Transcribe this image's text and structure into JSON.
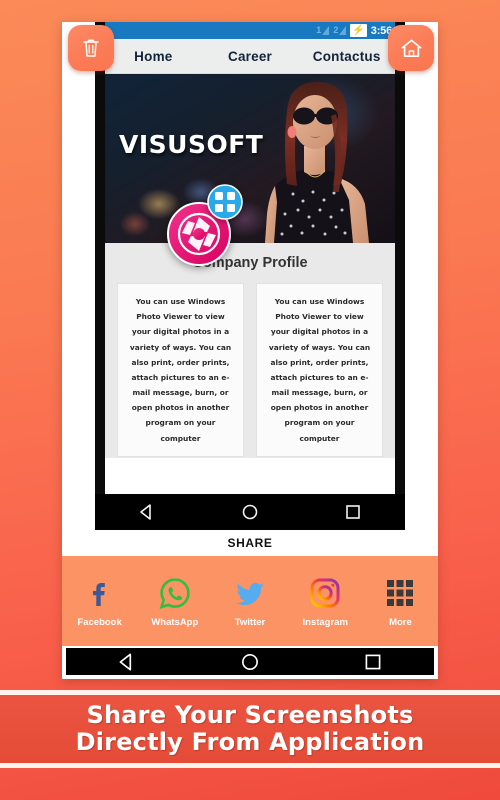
{
  "background": {
    "gradient_from": "#fb8a58",
    "gradient_to": "#ef4a3c"
  },
  "corner_actions": [
    {
      "name": "delete",
      "icon": "trash-icon",
      "color": "#fb7c57"
    },
    {
      "name": "home",
      "icon": "home-icon",
      "color": "#fb7c57"
    }
  ],
  "phone": {
    "status_bar": {
      "sim1_label": "1",
      "sim2_label": "2",
      "battery_icon": "⚡",
      "time": "3:56",
      "bg_color": "#1878c0"
    },
    "site_nav": {
      "items": [
        {
          "label": "Home"
        },
        {
          "label": "Career"
        },
        {
          "label": "Contactus"
        }
      ]
    },
    "hero": {
      "title": "VISUSOFT",
      "image_alt": "woman-with-sunglasses-night-bokeh"
    },
    "fab": {
      "shutter_icon": "camera-shutter-icon",
      "shutter_color": "#ec1d7a",
      "badge_icon": "grid-icon",
      "badge_color": "#29a9e8"
    },
    "profile": {
      "title": "Company Profile",
      "cards": [
        {
          "text": "You can use Windows Photo Viewer to view your digital photos in a variety of ways. You can also print, order prints, attach pictures to an e-mail message, burn, or open photos in another program on your computer"
        },
        {
          "text": "You can use Windows Photo Viewer to view your digital photos in a variety of ways. You can also print, order prints, attach pictures to an e-mail message, burn, or open photos in another program on your computer"
        }
      ]
    },
    "navbar": {
      "back_icon": "back-triangle-icon",
      "home_icon": "home-circle-icon",
      "recents_icon": "recents-square-icon"
    }
  },
  "share": {
    "label": "SHARE",
    "sheet_color": "#fb9365",
    "targets": [
      {
        "label": "Facebook",
        "icon": "facebook-icon",
        "color": "#3b5998"
      },
      {
        "label": "WhatsApp",
        "icon": "whatsapp-icon",
        "color": "#25d366"
      },
      {
        "label": "Twitter",
        "icon": "twitter-icon",
        "color": "#55acee"
      },
      {
        "label": "Instagram",
        "icon": "instagram-icon",
        "color": "#d6249f"
      },
      {
        "label": "More",
        "icon": "grid-more-icon",
        "color": "#3a3a3a"
      }
    ]
  },
  "system_navbar": {
    "back_icon": "back-triangle-icon",
    "home_icon": "home-circle-icon",
    "recents_icon": "recents-square-icon"
  },
  "caption": {
    "line1": "Share Your Screenshots",
    "line2": "Directly From Application",
    "bg_color": "#e54c38"
  }
}
